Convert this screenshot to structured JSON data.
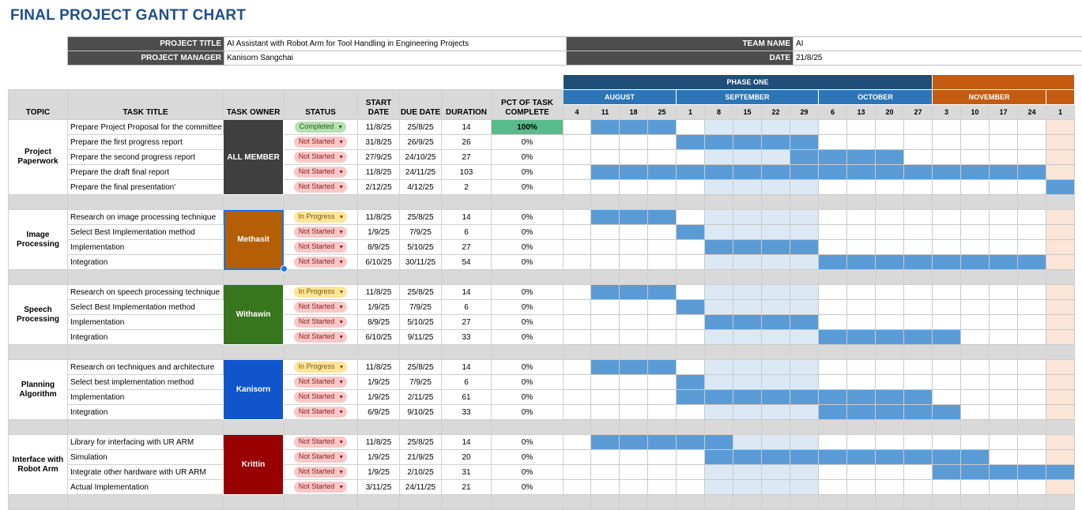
{
  "title": "FINAL PROJECT GANTT CHART",
  "project": {
    "title_label": "PROJECT TITLE",
    "title_value": "AI Assistant with Robot Arm for Tool Handling in Engineering Projects",
    "manager_label": "PROJECT MANAGER",
    "manager_value": "Kanisorn Sangchai",
    "team_label": "TEAM NAME",
    "team_value": "AI",
    "date_label": "DATE",
    "date_value": "21/8/25"
  },
  "headers": {
    "topic": "TOPIC",
    "task_title": "TASK TITLE",
    "task_owner": "TASK OWNER",
    "status": "STATUS",
    "start_date": "START DATE",
    "due_date": "DUE DATE",
    "duration": "DURATION",
    "pct": "PCT OF TASK COMPLETE"
  },
  "phase_label": "PHASE ONE",
  "months": [
    {
      "name": "AUGUST",
      "weeks": [
        "4",
        "11",
        "18",
        "25"
      ]
    },
    {
      "name": "SEPTEMBER",
      "weeks": [
        "1",
        "8",
        "15",
        "22",
        "29"
      ]
    },
    {
      "name": "OCTOBER",
      "weeks": [
        "6",
        "13",
        "20",
        "27"
      ]
    },
    {
      "name": "NOVEMBER",
      "weeks": [
        "3",
        "10",
        "17",
        "24"
      ]
    },
    {
      "name": "",
      "weeks": [
        "1"
      ]
    }
  ],
  "colors": {
    "owner_all": "#3f3f3f",
    "owner_methasit": "#b45f06",
    "owner_withawin": "#38761d",
    "owner_kanisorn": "#1155cc",
    "owner_krittin": "#990000",
    "bar": "#5b9bd5"
  },
  "groups": [
    {
      "topic": "Project Paperwork",
      "owner": "ALL MEMBER",
      "owner_color": "#3f3f3f",
      "tasks": [
        {
          "title": "Prepare Project Proposal for the committee",
          "status": "Completed",
          "start": "11/8/25",
          "due": "25/8/25",
          "duration": "14",
          "pct": "100%",
          "bars": [
            1,
            2,
            3
          ]
        },
        {
          "title": "Prepare the first progress report",
          "status": "Not Started",
          "start": "31/8/25",
          "due": "26/9/25",
          "duration": "26",
          "pct": "0%",
          "bars": [
            4,
            5,
            6,
            7,
            8
          ]
        },
        {
          "title": "Prepare the second progress report",
          "status": "Not Started",
          "start": "27/9/25",
          "due": "24/10/25",
          "duration": "27",
          "pct": "0%",
          "bars": [
            8,
            9,
            10,
            11
          ]
        },
        {
          "title": "Prepare the draft final report",
          "status": "Not Started",
          "start": "11/8/25",
          "due": "24/11/25",
          "duration": "103",
          "pct": "0%",
          "bars": [
            1,
            2,
            3,
            4,
            5,
            6,
            7,
            8,
            9,
            10,
            11,
            12,
            13,
            14,
            15,
            16
          ]
        },
        {
          "title": "Prepare the final presentation'",
          "status": "Not Started",
          "start": "2/12/25",
          "due": "4/12/25",
          "duration": "2",
          "pct": "0%",
          "bars": [
            17
          ]
        }
      ]
    },
    {
      "topic": "Image Processing",
      "owner": "Methasit",
      "owner_color": "#b45f06",
      "tasks": [
        {
          "title": "Research on image processing technique",
          "status": "In Progress",
          "start": "11/8/25",
          "due": "25/8/25",
          "duration": "14",
          "pct": "0%",
          "bars": [
            1,
            2,
            3
          ]
        },
        {
          "title": "Select Best Implementation method",
          "status": "Not Started",
          "start": "1/9/25",
          "due": "7/9/25",
          "duration": "6",
          "pct": "0%",
          "bars": [
            4
          ]
        },
        {
          "title": "Implementation",
          "status": "Not Started",
          "start": "8/9/25",
          "due": "5/10/25",
          "duration": "27",
          "pct": "0%",
          "bars": [
            5,
            6,
            7,
            8
          ]
        },
        {
          "title": "Integration",
          "status": "Not Started",
          "start": "6/10/25",
          "due": "30/11/25",
          "duration": "54",
          "pct": "0%",
          "bars": [
            9,
            10,
            11,
            12,
            13,
            14,
            15,
            16
          ]
        }
      ]
    },
    {
      "topic": "Speech Processing",
      "owner": "Withawin",
      "owner_color": "#38761d",
      "tasks": [
        {
          "title": "Research on speech processing technique",
          "status": "In Progress",
          "start": "11/8/25",
          "due": "25/8/25",
          "duration": "14",
          "pct": "0%",
          "bars": [
            1,
            2,
            3
          ]
        },
        {
          "title": "Select Best Implementation method",
          "status": "Not Started",
          "start": "1/9/25",
          "due": "7/9/25",
          "duration": "6",
          "pct": "0%",
          "bars": [
            4
          ]
        },
        {
          "title": "Implementation",
          "status": "Not Started",
          "start": "8/9/25",
          "due": "5/10/25",
          "duration": "27",
          "pct": "0%",
          "bars": [
            5,
            6,
            7,
            8
          ]
        },
        {
          "title": "Integration",
          "status": "Not Started",
          "start": "6/10/25",
          "due": "9/11/25",
          "duration": "33",
          "pct": "0%",
          "bars": [
            9,
            10,
            11,
            12,
            13
          ]
        }
      ]
    },
    {
      "topic": "Planning Algorithm",
      "owner": "Kanisorn",
      "owner_color": "#1155cc",
      "tasks": [
        {
          "title": "Research on techniques and architecture",
          "status": "In Progress",
          "start": "11/8/25",
          "due": "25/8/25",
          "duration": "14",
          "pct": "0%",
          "bars": [
            1,
            2,
            3
          ]
        },
        {
          "title": "Select best implementation method",
          "status": "Not Started",
          "start": "1/9/25",
          "due": "7/9/25",
          "duration": "6",
          "pct": "0%",
          "bars": [
            4
          ]
        },
        {
          "title": "Implementation",
          "status": "Not Started",
          "start": "1/9/25",
          "due": "2/11/25",
          "duration": "61",
          "pct": "0%",
          "bars": [
            4,
            5,
            6,
            7,
            8,
            9,
            10,
            11,
            12
          ]
        },
        {
          "title": "Integration",
          "status": "Not Started",
          "start": "6/9/25",
          "due": "9/10/25",
          "duration": "33",
          "pct": "0%",
          "bars": [
            9,
            10,
            11,
            12,
            13
          ]
        }
      ]
    },
    {
      "topic": "Interface with Robot Arm",
      "owner": "Krittin",
      "owner_color": "#990000",
      "tasks": [
        {
          "title": "Library for interfacing with UR ARM",
          "status": "Not Started",
          "start": "11/8/25",
          "due": "25/8/25",
          "duration": "14",
          "pct": "0%",
          "bars": [
            1,
            2,
            3,
            4,
            5
          ]
        },
        {
          "title": "Simulation",
          "status": "Not Started",
          "start": "1/9/25",
          "due": "21/9/25",
          "duration": "20",
          "pct": "0%",
          "bars": [
            5,
            6,
            7,
            8,
            9,
            10,
            11,
            12,
            13,
            14
          ]
        },
        {
          "title": "Integrate other hardware with UR ARM",
          "status": "Not Started",
          "start": "1/9/25",
          "due": "2/10/25",
          "duration": "31",
          "pct": "0%",
          "bars": [
            13,
            14,
            15,
            16,
            17
          ]
        },
        {
          "title": "Actual Implementation",
          "status": "Not Started",
          "start": "3/11/25",
          "due": "24/11/25",
          "duration": "21",
          "pct": "0%",
          "bars": []
        }
      ]
    }
  ]
}
